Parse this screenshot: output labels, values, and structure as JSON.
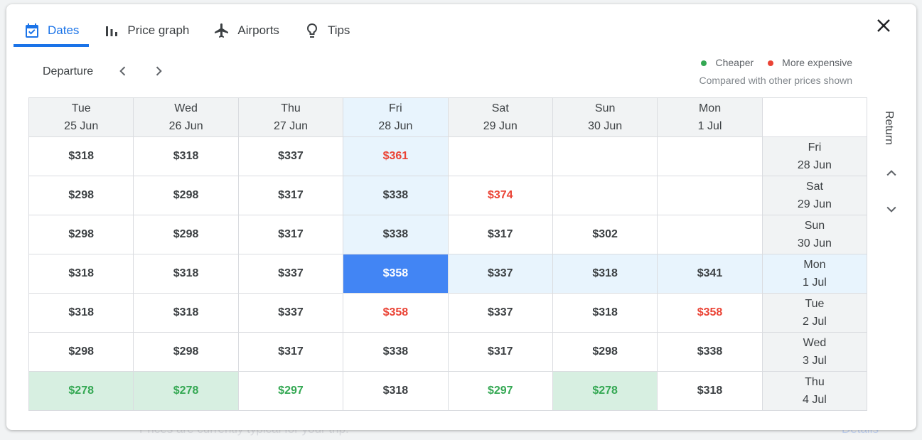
{
  "background": {
    "message": "Prices are currently typical for your trip.",
    "details_link": "Details"
  },
  "tabs": [
    {
      "label": "Dates",
      "icon": "calendar-check-icon",
      "active": true
    },
    {
      "label": "Price graph",
      "icon": "bar-chart-icon",
      "active": false
    },
    {
      "label": "Airports",
      "icon": "airplane-icon",
      "active": false
    },
    {
      "label": "Tips",
      "icon": "lightbulb-icon",
      "active": false
    }
  ],
  "departure_label": "Departure",
  "return_label": "Return",
  "legend": {
    "cheaper": "Cheaper",
    "more_expensive": "More expensive",
    "note": "Compared with other prices shown",
    "cheaper_color": "#34a853",
    "expensive_color": "#ea4335"
  },
  "accent_color": "#1a73e8",
  "selected": {
    "departure_index": 3,
    "return_index": 3
  },
  "departure_dates": [
    {
      "day": "Tue",
      "date": "25 Jun"
    },
    {
      "day": "Wed",
      "date": "26 Jun"
    },
    {
      "day": "Thu",
      "date": "27 Jun"
    },
    {
      "day": "Fri",
      "date": "28 Jun"
    },
    {
      "day": "Sat",
      "date": "29 Jun"
    },
    {
      "day": "Sun",
      "date": "30 Jun"
    },
    {
      "day": "Mon",
      "date": "1 Jul"
    }
  ],
  "return_dates": [
    {
      "day": "Fri",
      "date": "28 Jun"
    },
    {
      "day": "Sat",
      "date": "29 Jun"
    },
    {
      "day": "Sun",
      "date": "30 Jun"
    },
    {
      "day": "Mon",
      "date": "1 Jul"
    },
    {
      "day": "Tue",
      "date": "2 Jul"
    },
    {
      "day": "Wed",
      "date": "3 Jul"
    },
    {
      "day": "Thu",
      "date": "4 Jul"
    }
  ],
  "prices": [
    [
      {
        "p": "$318"
      },
      {
        "p": "$318"
      },
      {
        "p": "$337"
      },
      {
        "p": "$361",
        "t": "red"
      },
      {
        "p": ""
      },
      {
        "p": ""
      },
      {
        "p": ""
      }
    ],
    [
      {
        "p": "$298"
      },
      {
        "p": "$298"
      },
      {
        "p": "$317"
      },
      {
        "p": "$338"
      },
      {
        "p": "$374",
        "t": "red"
      },
      {
        "p": ""
      },
      {
        "p": ""
      }
    ],
    [
      {
        "p": "$298"
      },
      {
        "p": "$298"
      },
      {
        "p": "$317"
      },
      {
        "p": "$338"
      },
      {
        "p": "$317"
      },
      {
        "p": "$302"
      },
      {
        "p": ""
      }
    ],
    [
      {
        "p": "$318"
      },
      {
        "p": "$318"
      },
      {
        "p": "$337"
      },
      {
        "p": "$358"
      },
      {
        "p": "$337"
      },
      {
        "p": "$318"
      },
      {
        "p": "$341"
      }
    ],
    [
      {
        "p": "$318"
      },
      {
        "p": "$318"
      },
      {
        "p": "$337"
      },
      {
        "p": "$358",
        "t": "red"
      },
      {
        "p": "$337"
      },
      {
        "p": "$318"
      },
      {
        "p": "$358",
        "t": "red"
      }
    ],
    [
      {
        "p": "$298"
      },
      {
        "p": "$298"
      },
      {
        "p": "$317"
      },
      {
        "p": "$338"
      },
      {
        "p": "$317"
      },
      {
        "p": "$298"
      },
      {
        "p": "$338"
      }
    ],
    [
      {
        "p": "$278",
        "t": "greenbg"
      },
      {
        "p": "$278",
        "t": "greenbg"
      },
      {
        "p": "$297",
        "t": "green"
      },
      {
        "p": "$318"
      },
      {
        "p": "$297",
        "t": "green"
      },
      {
        "p": "$278",
        "t": "greenbg"
      },
      {
        "p": "$318"
      }
    ]
  ]
}
